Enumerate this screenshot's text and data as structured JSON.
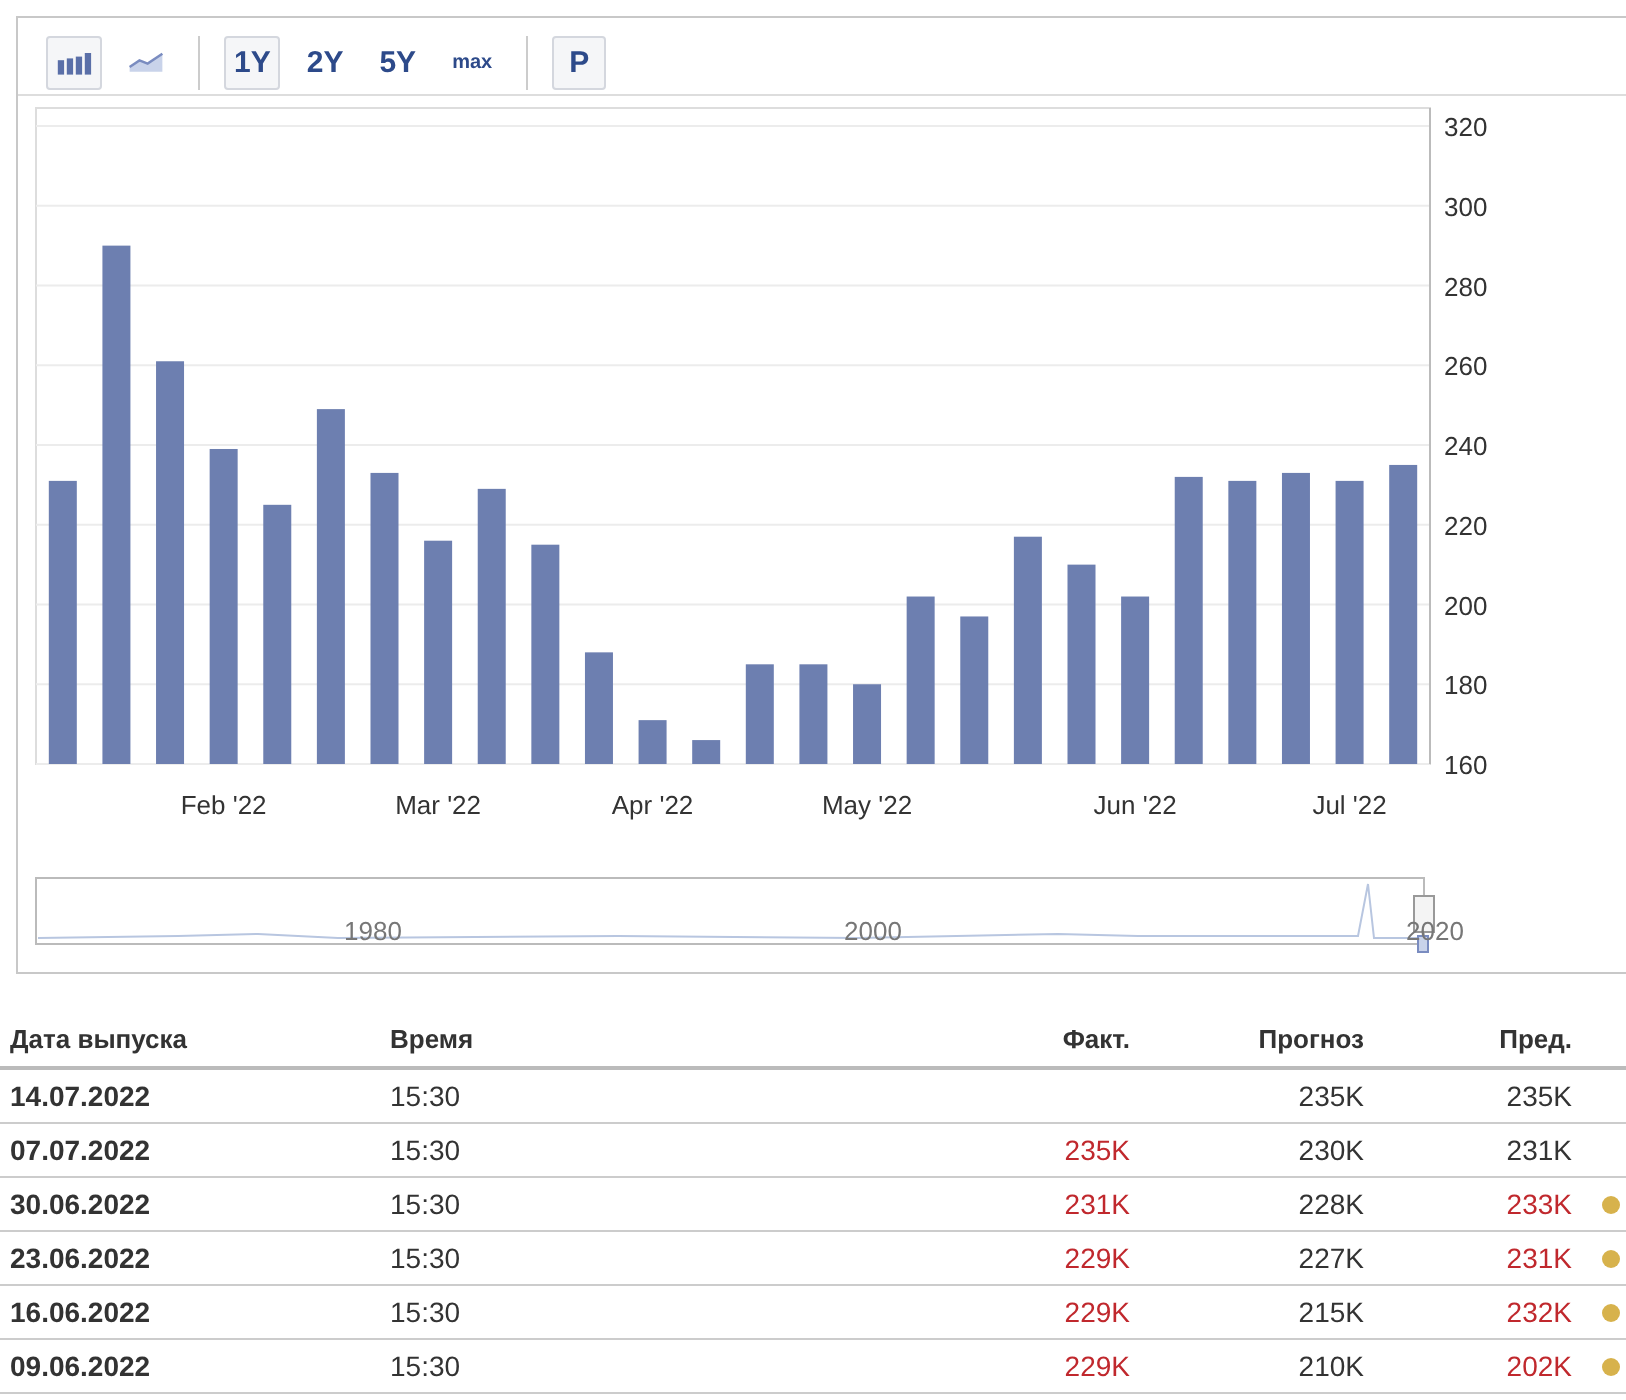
{
  "toolbar": {
    "chart_types": [
      {
        "kind": "bar",
        "selected": true
      },
      {
        "kind": "line",
        "selected": false
      }
    ],
    "periods": [
      {
        "label": "1Y",
        "selected": true
      },
      {
        "label": "2Y",
        "selected": false
      },
      {
        "label": "5Y",
        "selected": false
      },
      {
        "label": "max",
        "selected": false
      }
    ],
    "extra_button": "P"
  },
  "chart": {
    "chart_data": {
      "type": "bar",
      "categories": [
        null,
        null,
        null,
        "Feb '22",
        null,
        null,
        null,
        "Mar '22",
        null,
        null,
        null,
        "Apr '22",
        null,
        null,
        null,
        "May '22",
        null,
        null,
        null,
        null,
        "Jun '22",
        null,
        null,
        null,
        "Jul '22",
        null
      ],
      "series": [
        {
          "color": "#6d7fb0",
          "values": [
            231,
            290,
            261,
            239,
            225,
            249,
            233,
            216,
            229,
            215,
            188,
            171,
            166,
            185,
            185,
            180,
            202,
            197,
            217,
            210,
            202,
            232,
            231,
            233,
            231,
            235
          ]
        }
      ],
      "grid": true,
      "ylim": [
        160,
        320
      ],
      "yticks": [
        160,
        180,
        200,
        220,
        240,
        260,
        280,
        300,
        320
      ]
    },
    "navigator_labels": [
      "1980",
      "2000",
      "2020"
    ]
  },
  "table": {
    "columns": [
      "Дата выпуска",
      "Время",
      "Факт.",
      "Прогноз",
      "Пред."
    ],
    "rows": [
      {
        "date": "14.07.2022",
        "time": "15:30",
        "actual": "",
        "forecast": "235K",
        "previous": "235K",
        "previous_negative": false,
        "revised": false
      },
      {
        "date": "07.07.2022",
        "time": "15:30",
        "actual": "235K",
        "forecast": "230K",
        "previous": "231K",
        "actual_negative": true,
        "previous_negative": false,
        "revised": false
      },
      {
        "date": "30.06.2022",
        "time": "15:30",
        "actual": "231K",
        "forecast": "228K",
        "previous": "233K",
        "actual_negative": true,
        "previous_negative": true,
        "revised": true
      },
      {
        "date": "23.06.2022",
        "time": "15:30",
        "actual": "229K",
        "forecast": "227K",
        "previous": "231K",
        "actual_negative": true,
        "previous_negative": true,
        "revised": true
      },
      {
        "date": "16.06.2022",
        "time": "15:30",
        "actual": "229K",
        "forecast": "215K",
        "previous": "232K",
        "actual_negative": true,
        "previous_negative": true,
        "revised": true
      },
      {
        "date": "09.06.2022",
        "time": "15:30",
        "actual": "229K",
        "forecast": "210K",
        "previous": "202K",
        "actual_negative": true,
        "previous_negative": true,
        "revised": true
      }
    ]
  }
}
